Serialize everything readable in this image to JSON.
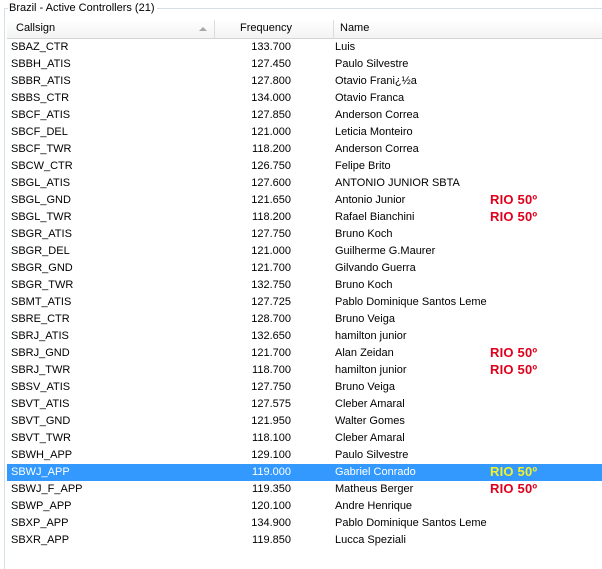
{
  "panel": {
    "title": "Brazil - Active Controllers (21)"
  },
  "columns": {
    "callsign": "Callsign",
    "frequency": "Frequency",
    "name": "Name"
  },
  "badge_color": "#e0001b",
  "selected_badge_color": "#f2f227",
  "selection_color": "#3399ff",
  "rows": [
    {
      "callsign": "SBAZ_CTR",
      "frequency": "133.700",
      "name": "Luis",
      "badge": ""
    },
    {
      "callsign": "SBBH_ATIS",
      "frequency": "127.450",
      "name": "Paulo Silvestre",
      "badge": ""
    },
    {
      "callsign": "SBBR_ATIS",
      "frequency": "127.800",
      "name": "Otavio Frani¿½a",
      "badge": ""
    },
    {
      "callsign": "SBBS_CTR",
      "frequency": "134.000",
      "name": "Otavio Franca",
      "badge": ""
    },
    {
      "callsign": "SBCF_ATIS",
      "frequency": "127.850",
      "name": "Anderson Correa",
      "badge": ""
    },
    {
      "callsign": "SBCF_DEL",
      "frequency": "121.000",
      "name": "Leticia Monteiro",
      "badge": ""
    },
    {
      "callsign": "SBCF_TWR",
      "frequency": "118.200",
      "name": "Anderson Correa",
      "badge": ""
    },
    {
      "callsign": "SBCW_CTR",
      "frequency": "126.750",
      "name": "Felipe Brito",
      "badge": ""
    },
    {
      "callsign": "SBGL_ATIS",
      "frequency": "127.600",
      "name": "ANTONIO JUNIOR SBTA",
      "badge": ""
    },
    {
      "callsign": "SBGL_GND",
      "frequency": "121.650",
      "name": "Antonio Junior",
      "badge": "RIO 50º"
    },
    {
      "callsign": "SBGL_TWR",
      "frequency": "118.200",
      "name": "Rafael Bianchini",
      "badge": "RIO 50º"
    },
    {
      "callsign": "SBGR_ATIS",
      "frequency": "127.750",
      "name": "Bruno Koch",
      "badge": ""
    },
    {
      "callsign": "SBGR_DEL",
      "frequency": "121.000",
      "name": "Guilherme G.Maurer",
      "badge": ""
    },
    {
      "callsign": "SBGR_GND",
      "frequency": "121.700",
      "name": "Gilvando Guerra",
      "badge": ""
    },
    {
      "callsign": "SBGR_TWR",
      "frequency": "132.750",
      "name": "Bruno Koch",
      "badge": ""
    },
    {
      "callsign": "SBMT_ATIS",
      "frequency": "127.725",
      "name": "Pablo Dominique Santos Leme",
      "badge": ""
    },
    {
      "callsign": "SBRE_CTR",
      "frequency": "128.700",
      "name": "Bruno Veiga",
      "badge": ""
    },
    {
      "callsign": "SBRJ_ATIS",
      "frequency": "132.650",
      "name": "hamilton junior",
      "badge": ""
    },
    {
      "callsign": "SBRJ_GND",
      "frequency": "121.700",
      "name": "Alan Zeidan",
      "badge": "RIO 50º"
    },
    {
      "callsign": "SBRJ_TWR",
      "frequency": "118.700",
      "name": "hamilton junior",
      "badge": "RIO 50º"
    },
    {
      "callsign": "SBSV_ATIS",
      "frequency": "127.750",
      "name": "Bruno Veiga",
      "badge": ""
    },
    {
      "callsign": "SBVT_ATIS",
      "frequency": "127.575",
      "name": "Cleber Amaral",
      "badge": ""
    },
    {
      "callsign": "SBVT_GND",
      "frequency": "121.950",
      "name": "Walter Gomes",
      "badge": ""
    },
    {
      "callsign": "SBVT_TWR",
      "frequency": "118.100",
      "name": "Cleber Amaral",
      "badge": ""
    },
    {
      "callsign": "SBWH_APP",
      "frequency": "129.100",
      "name": "Paulo Silvestre",
      "badge": ""
    },
    {
      "callsign": "SBWJ_APP",
      "frequency": "119.000",
      "name": "Gabriel Conrado",
      "badge": "RIO 50º",
      "selected": true
    },
    {
      "callsign": "SBWJ_F_APP",
      "frequency": "119.350",
      "name": "Matheus Berger",
      "badge": "RIO 50º"
    },
    {
      "callsign": "SBWP_APP",
      "frequency": "120.100",
      "name": "Andre Henrique",
      "badge": ""
    },
    {
      "callsign": "SBXP_APP",
      "frequency": "134.900",
      "name": "Pablo Dominique Santos Leme",
      "badge": ""
    },
    {
      "callsign": "SBXR_APP",
      "frequency": "119.850",
      "name": "Lucca Speziali",
      "badge": ""
    }
  ]
}
